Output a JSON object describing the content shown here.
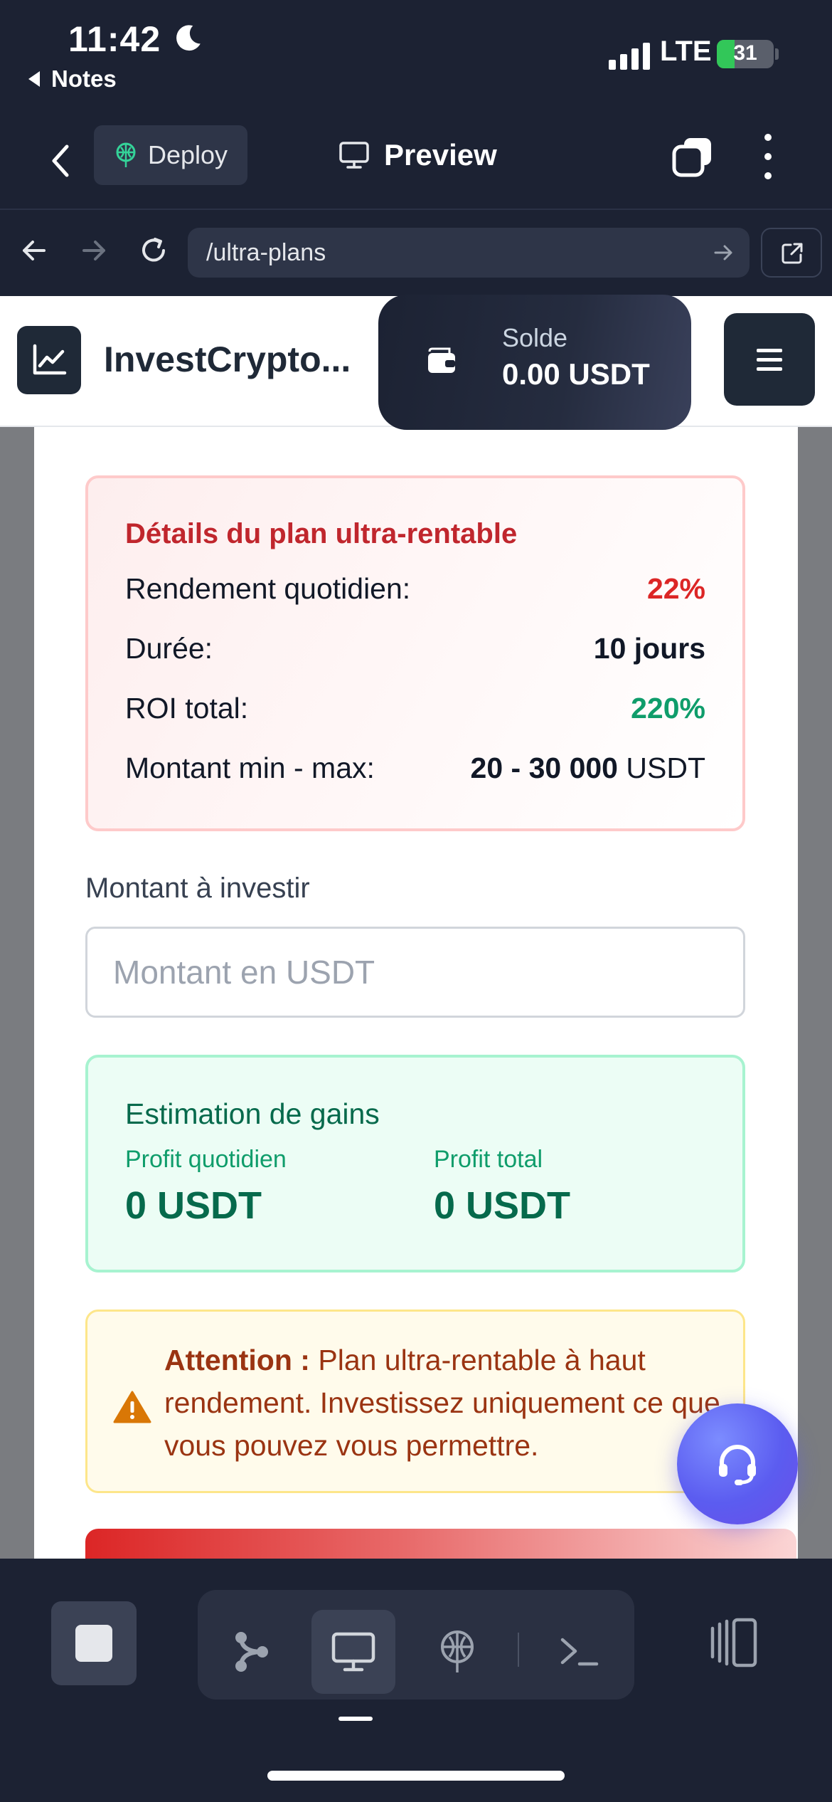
{
  "status_bar": {
    "time": "11:42",
    "back_app": "Notes",
    "network": "LTE",
    "battery": "31",
    "battery_level": 0.31
  },
  "toolbar": {
    "deploy_label": "Deploy",
    "preview_label": "Preview"
  },
  "browser": {
    "url": "/ultra-plans"
  },
  "site_header": {
    "brand": "InvestCrypto...",
    "balance_label": "Solde",
    "balance_value": "0.00 USDT"
  },
  "plan_details": {
    "title": "Détails du plan ultra-rentable",
    "rows": [
      {
        "label": "Rendement quotidien:",
        "value": "22%"
      },
      {
        "label": "Durée:",
        "value": "10 jours"
      },
      {
        "label": "ROI total:",
        "value": "220%"
      },
      {
        "label": "Montant min - max:",
        "value": "20 - 30 000",
        "unit": "USDT"
      }
    ]
  },
  "investment_form": {
    "amount_label": "Montant à investir",
    "amount_placeholder": "Montant en USDT",
    "amount_value": ""
  },
  "gain_estimate": {
    "title": "Estimation de gains",
    "daily_label": "Profit quotidien",
    "daily_value": "0 USDT",
    "total_label": "Profit total",
    "total_value": "0 USDT"
  },
  "warning": {
    "title": "Attention :",
    "text": "Plan ultra-rentable à haut rendement. Investissez uniquement ce que vous pouvez vous permettre."
  },
  "colors": {
    "app_dark": "#1c2233",
    "accent_red": "#dc2626",
    "accent_green": "#0f9d6b",
    "warning_brown": "#9a3412",
    "fab_purple": "#5b5cf0"
  },
  "icons": {
    "status": [
      "moon-icon",
      "signal-icon",
      "battery-icon"
    ],
    "toolbar": [
      "back-chevron-icon",
      "deploy-icon",
      "monitor-icon",
      "tabs-icon",
      "more-vertical-icon"
    ],
    "browser": [
      "arrow-left-icon",
      "arrow-right-icon",
      "reload-icon",
      "go-arrow-icon",
      "external-link-icon"
    ],
    "site": [
      "chart-line-icon",
      "wallet-icon",
      "menu-icon",
      "warning-triangle-icon",
      "headset-icon"
    ],
    "bottom": [
      "stop-icon",
      "workflow-icon",
      "monitor-icon",
      "deploy-icon",
      "terminal-icon",
      "split-view-icon"
    ]
  }
}
